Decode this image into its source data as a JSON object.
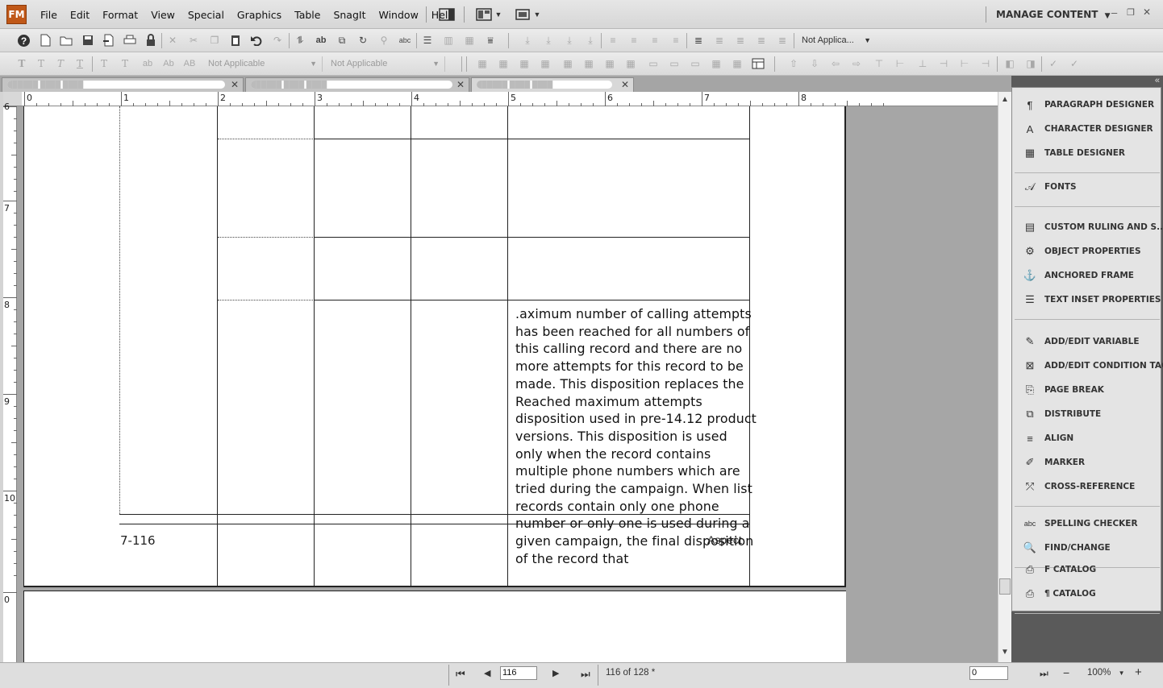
{
  "app": {
    "logo": "FM",
    "menu": [
      "File",
      "Edit",
      "Format",
      "View",
      "Special",
      "Graphics",
      "Table",
      "SnagIt",
      "Window",
      "Help"
    ],
    "manage_content": "MANAGE CONTENT",
    "win_min": "–",
    "win_restore": "❐",
    "win_close": "✕"
  },
  "toolbar1": {
    "dropdown_value": "Not Applica..."
  },
  "toolbar2": {
    "char_tag_dropdown": "Not Applicable",
    "cond_tag_dropdown": "Not Applicable"
  },
  "tabs": [
    {
      "label": "██████ ████ ████"
    },
    {
      "label": "██████ ████ ████"
    },
    {
      "label": "██████ ████ ████"
    }
  ],
  "ruler": {
    "h_labels": [
      "0",
      "1",
      "2",
      "3",
      "4",
      "5",
      "6",
      "7",
      "8"
    ],
    "v_labels": [
      "6",
      "7",
      "8",
      "9",
      "10",
      "0"
    ]
  },
  "document": {
    "cell_text": ".aximum number of calling attempts has been reached for all numbers of this calling record and there are no more attempts for this record to be made. This disposition replaces the Reached maximum attempts disposition used in pre-14.12 product versions. This disposition is used only when the record contains multiple phone numbers which are tried during the campaign. When list records contain only one phone number or only one is used during a given campaign, the final disposition of the record that",
    "footer_page": "7-116",
    "overflow_text": "Aspect"
  },
  "panel": {
    "groups": [
      [
        {
          "icon": "¶",
          "label": "PARAGRAPH DESIGNER"
        },
        {
          "icon": "A",
          "label": "CHARACTER DESIGNER"
        },
        {
          "icon": "▦",
          "label": "TABLE DESIGNER"
        }
      ],
      [
        {
          "icon": "𝒜",
          "label": "FONTS"
        }
      ],
      [
        {
          "icon": "▤",
          "label": "CUSTOM RULING AND S..."
        },
        {
          "icon": "⚙",
          "label": "OBJECT PROPERTIES"
        },
        {
          "icon": "⚓",
          "label": "ANCHORED FRAME"
        },
        {
          "icon": "☰",
          "label": "TEXT INSET PROPERTIES"
        }
      ],
      [
        {
          "icon": "✎",
          "label": "ADD/EDIT VARIABLE"
        },
        {
          "icon": "⊠",
          "label": "ADD/EDIT CONDITION TAG"
        },
        {
          "icon": "⎘",
          "label": "PAGE BREAK"
        },
        {
          "icon": "⧉",
          "label": "DISTRIBUTE"
        },
        {
          "icon": "≡",
          "label": "ALIGN"
        },
        {
          "icon": "✐",
          "label": "MARKER"
        },
        {
          "icon": "⤱",
          "label": "CROSS-REFERENCE"
        }
      ],
      [
        {
          "icon": "abc",
          "label": "SPELLING CHECKER"
        },
        {
          "icon": "🔍",
          "label": "FIND/CHANGE"
        }
      ],
      [
        {
          "icon": "⎙",
          "label": "F CATALOG"
        },
        {
          "icon": "⎙",
          "label": "¶ CATALOG"
        }
      ]
    ]
  },
  "status": {
    "page_input": "116",
    "page_count": "116 of 128 *",
    "coord_input": "0",
    "zoom": "100%"
  }
}
